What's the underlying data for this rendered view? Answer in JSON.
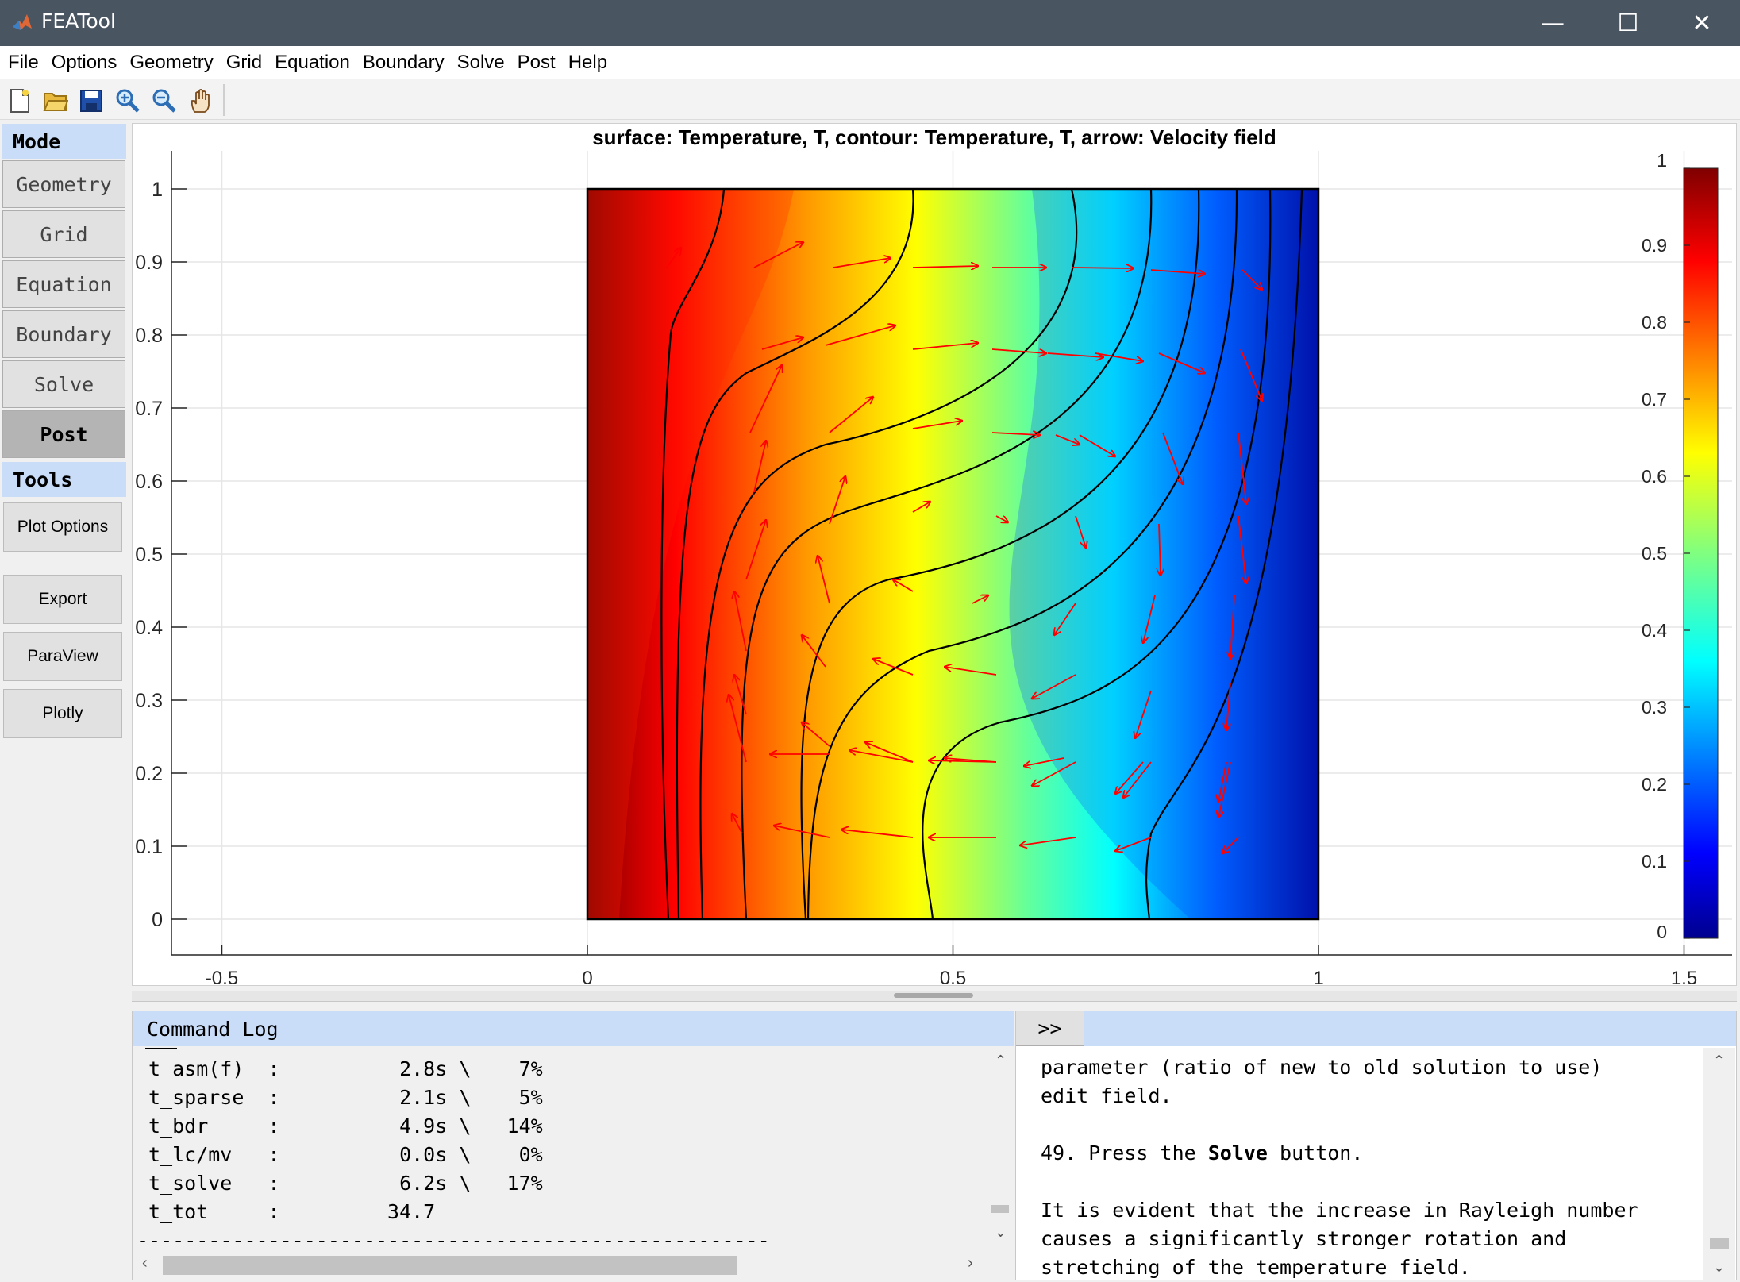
{
  "window": {
    "title": "FEATool",
    "minimize_glyph": "—",
    "maximize_glyph": "☐",
    "close_glyph": "✕"
  },
  "menu": [
    "File",
    "Options",
    "Geometry",
    "Grid",
    "Equation",
    "Boundary",
    "Solve",
    "Post",
    "Help"
  ],
  "toolbar_icons": [
    "new-file-icon",
    "open-folder-icon",
    "save-icon",
    "zoom-in-icon",
    "zoom-out-icon",
    "pan-hand-icon"
  ],
  "sidebar": {
    "mode_header": "Mode",
    "modes": [
      "Geometry",
      "Grid",
      "Equation",
      "Boundary",
      "Solve",
      "Post"
    ],
    "active_mode": "Post",
    "tools_header": "Tools",
    "tools": [
      "Plot Options",
      "Export",
      "ParaView",
      "Plotly"
    ]
  },
  "plot": {
    "title": "surface: Temperature, T, contour: Temperature, T, arrow: Velocity field",
    "colormap": "jet",
    "x_axis": {
      "range": [
        -0.6,
        1.55
      ],
      "ticks": [
        "-0.5",
        "0",
        "0.5",
        "1",
        "1.5"
      ]
    },
    "y_axis": {
      "range": [
        -0.05,
        1.05
      ],
      "ticks": [
        "0",
        "0.1",
        "0.2",
        "0.3",
        "0.4",
        "0.5",
        "0.6",
        "0.7",
        "0.8",
        "0.9",
        "1"
      ]
    },
    "colorbar": {
      "range": [
        0,
        1
      ],
      "ticks": [
        "0",
        "0.1",
        "0.2",
        "0.3",
        "0.4",
        "0.5",
        "0.6",
        "0.7",
        "0.8",
        "0.9",
        "1"
      ]
    }
  },
  "command_log": {
    "header": "Command Log",
    "lines": [
      "t_asm(f)  :          2.8s \\    7%",
      "t_sparse  :          2.1s \\    5%",
      "t_bdr     :          4.9s \\   14%",
      "t_lc/mv   :          0.0s \\    0%",
      "t_solve   :          6.2s \\   17%",
      "t_tot     :         34.7",
      "-----------------------------------------------------"
    ]
  },
  "tutorial": {
    "toggle_label": ">>",
    "line1": "parameter (ratio of new to old solution to use)",
    "line2": "edit field.",
    "step_prefix": "49. Press the ",
    "step_bold": "Solve",
    "step_suffix": " button.",
    "para_l1": "It is evident that the increase in Rayleigh number",
    "para_l2": "causes a significantly stronger rotation and",
    "para_l3": "stretching of the temperature field."
  }
}
